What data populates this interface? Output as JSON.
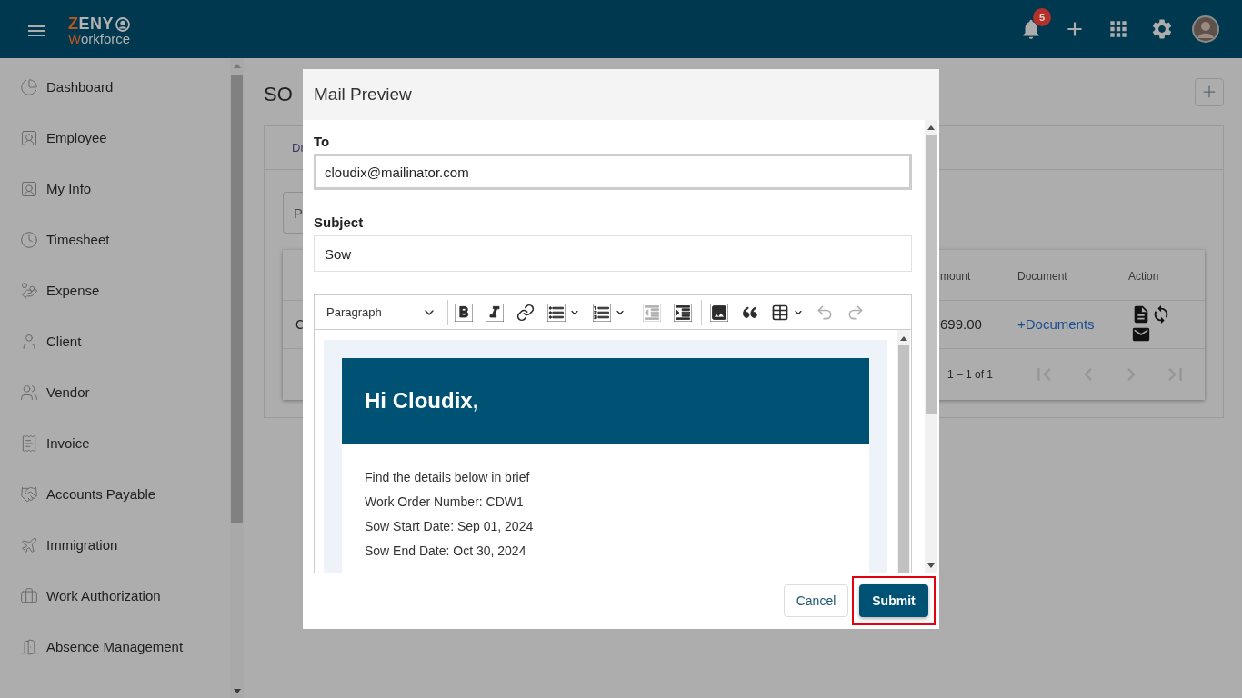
{
  "header": {
    "logo": {
      "title": "ZENY",
      "subtitle": "Workforce"
    },
    "notifications": {
      "count": "5"
    }
  },
  "sidebar": {
    "items": [
      {
        "label": "Dashboard"
      },
      {
        "label": "Employee"
      },
      {
        "label": "My Info"
      },
      {
        "label": "Timesheet"
      },
      {
        "label": "Expense"
      },
      {
        "label": "Client"
      },
      {
        "label": "Vendor"
      },
      {
        "label": "Invoice"
      },
      {
        "label": "Accounts Payable"
      },
      {
        "label": "Immigration"
      },
      {
        "label": "Work Authorization"
      },
      {
        "label": "Absence Management"
      }
    ]
  },
  "page": {
    "title": "SO",
    "tabs": [
      {
        "label": "Dr"
      }
    ],
    "filter": {
      "placeholder": "P"
    },
    "table": {
      "columns": [
        "mount",
        "Document",
        "Action"
      ],
      "rows": [
        {
          "column_1": "C",
          "column_2": "699.00",
          "document": "+Documents"
        }
      ],
      "pagination": {
        "range": "1 – 1 of 1",
        "buttons": [
          {
            "kind": "first",
            "disabled": true
          },
          {
            "kind": "previous",
            "disabled": true
          },
          {
            "kind": "next",
            "disabled": true
          },
          {
            "kind": "last",
            "disabled": true
          }
        ]
      }
    }
  },
  "dialog": {
    "title": "Mail Preview",
    "fields": [
      {
        "label": "To",
        "value": "cloudix@mailinator.com",
        "focused": true
      },
      {
        "label": "Subject",
        "value": "Sow",
        "focused": false
      }
    ],
    "editor": {
      "format": "Paragraph",
      "toolbar": [
        [
          {
            "kind": "bold",
            "disabled": false
          },
          {
            "kind": "italic",
            "disabled": false
          },
          {
            "kind": "link",
            "disabled": false
          },
          {
            "kind": "bulleted_list",
            "disabled": false
          },
          {
            "kind": "numbered_list",
            "disabled": false
          }
        ],
        [
          {
            "kind": "outdent",
            "disabled": true
          },
          {
            "kind": "indent",
            "disabled": false
          }
        ],
        [
          {
            "kind": "image",
            "disabled": false
          },
          {
            "kind": "quote",
            "disabled": false
          },
          {
            "kind": "table",
            "disabled": false
          },
          {
            "kind": "undo",
            "disabled": true
          },
          {
            "kind": "redo",
            "disabled": true
          }
        ]
      ],
      "greeting": "Hi Cloudix,",
      "lines": [
        "Find the details below in brief",
        "Work Order Number: CDW1",
        "Sow Start Date: Sep 01, 2024",
        "Sow End Date: Oct 30, 2024"
      ]
    },
    "actions": [
      {
        "label": "Cancel",
        "kind": "secondary",
        "highlighted": false
      },
      {
        "label": "Submit",
        "kind": "primary",
        "highlighted": true
      }
    ]
  }
}
